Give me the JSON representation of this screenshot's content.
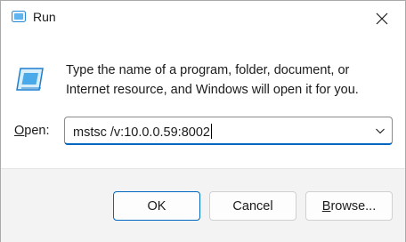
{
  "window": {
    "title": "Run"
  },
  "icons": {
    "title": "run-icon",
    "app": "run-icon",
    "close": "close-icon",
    "dropdown": "chevron-down-icon"
  },
  "message": {
    "line1": "Type the name of a program, folder, document, or",
    "line2": "Internet resource, and Windows will open it for you."
  },
  "open": {
    "label_mnemonic": "O",
    "label_rest": "pen:",
    "value": "mstsc /v:10.0.0.59:8002"
  },
  "buttons": {
    "ok": "OK",
    "cancel": "Cancel",
    "browse_mnemonic": "B",
    "browse_rest": "rowse..."
  },
  "colors": {
    "accent": "#0067c0",
    "footer_bg": "#f3f3f3"
  }
}
